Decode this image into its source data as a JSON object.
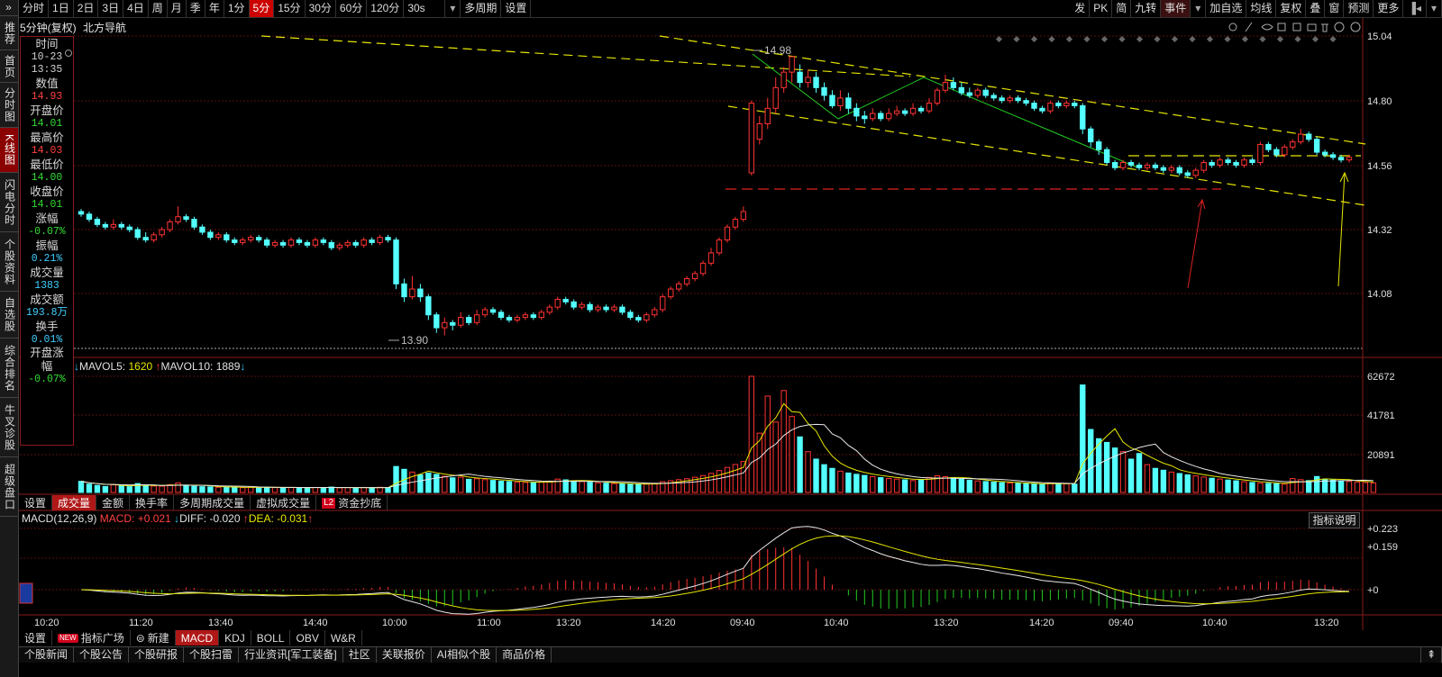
{
  "leftnav": [
    "推荐",
    "首页",
    "分时图",
    "K线图",
    "闪电分时",
    "个股资料",
    "自选股",
    "综合排名",
    "牛叉诊股",
    "超级盘口"
  ],
  "leftnav_expand": "»",
  "toolbar": {
    "periods": [
      "分时",
      "1日",
      "2日",
      "3日",
      "4日",
      "周",
      "月",
      "季",
      "年",
      "1分",
      "5分",
      "15分",
      "30分",
      "60分",
      "120分",
      "30s",
      "多周期",
      "设置"
    ],
    "active_period": "5分",
    "right": [
      "发",
      "PK",
      "简",
      "九转",
      "事件",
      "加自选",
      "均线",
      "复权",
      "叠",
      "窗",
      "预测",
      "更多"
    ]
  },
  "stock": {
    "period_label": "5分钟(复权)",
    "name": "北方导航"
  },
  "info": [
    {
      "label": "时间",
      "value": "10-23",
      "color": "#d0d0d0"
    },
    {
      "label": "",
      "value": "13:35",
      "color": "#d0d0d0"
    },
    {
      "label": "数值",
      "value": "14.93",
      "color": "#ff4040"
    },
    {
      "label": "开盘价",
      "value": "14.01",
      "color": "#33dd33"
    },
    {
      "label": "最高价",
      "value": "14.03",
      "color": "#ff4040"
    },
    {
      "label": "最低价",
      "value": "14.00",
      "color": "#33dd33"
    },
    {
      "label": "收盘价",
      "value": "14.01",
      "color": "#33dd33"
    },
    {
      "label": "涨幅",
      "value": "-0.07%",
      "color": "#33dd33"
    },
    {
      "label": "振幅",
      "value": "0.21%",
      "color": "#3ecfff"
    },
    {
      "label": "成交量",
      "value": "1383",
      "color": "#3ecfff"
    },
    {
      "label": "成交额",
      "value": "193.8万",
      "color": "#3ecfff"
    },
    {
      "label": "换手",
      "value": "0.01%",
      "color": "#3ecfff"
    },
    {
      "label": "开盘涨幅",
      "value": "-0.07%",
      "color": "#33dd33"
    }
  ],
  "price_axis": [
    "15.04",
    "14.80",
    "14.56",
    "14.32",
    "14.08"
  ],
  "vol_axis": [
    "62672",
    "41781",
    "20891"
  ],
  "macd_axis": [
    "+0.223",
    "+0.159",
    "+0"
  ],
  "annotations": {
    "high": "14.98",
    "low": "13.90"
  },
  "vol_legend": {
    "ma5_label": "MAVOL5:",
    "ma5": "1620",
    "ma10_label": "MAVOL10:",
    "ma10": "1889"
  },
  "vol_tabs": [
    "设置",
    "成交量",
    "金额",
    "换手率",
    "多周期成交量",
    "虚拟成交量",
    "资金抄底"
  ],
  "vol_tab_active": "成交量",
  "macd_legend": {
    "name": "MACD(12,26,9)",
    "macd_label": "MACD:",
    "macd": "+0.021",
    "diff_label": "DIFF:",
    "diff": "-0.020",
    "dea_label": "DEA:",
    "dea": "-0.031"
  },
  "indicator_button": "指标说明",
  "time_axis": [
    "10:20",
    "11:20",
    "13:40",
    "14:40",
    "10:00",
    "11:00",
    "13:20",
    "14:20",
    "09:40",
    "10:40",
    "13:20",
    "14:20",
    "09:40",
    "10:40",
    "13:20"
  ],
  "indic_tabs": [
    "设置",
    "指标广场",
    "新建",
    "MACD",
    "KDJ",
    "BOLL",
    "OBV",
    "W&R"
  ],
  "indic_tab_active": "MACD",
  "new_badge": "NEW",
  "l2_badge": "L2",
  "news_tabs": [
    "个股新闻",
    "个股公告",
    "个股研报",
    "个股扫雷",
    "行业资讯[军工装备]",
    "社区",
    "关联报价",
    "AI相似个股",
    "商品价格"
  ],
  "chart_data": {
    "type": "candlestick",
    "price_range": [
      13.85,
      15.06
    ],
    "candles": [
      [
        14.38,
        14.37,
        14.39,
        14.36
      ],
      [
        14.37,
        14.35,
        14.38,
        14.34
      ],
      [
        14.35,
        14.33,
        14.36,
        14.32
      ],
      [
        14.33,
        14.32,
        14.34,
        14.31
      ],
      [
        14.32,
        14.33,
        14.35,
        14.31
      ],
      [
        14.33,
        14.32,
        14.34,
        14.31
      ],
      [
        14.32,
        14.31,
        14.33,
        14.3
      ],
      [
        14.31,
        14.28,
        14.32,
        14.27
      ],
      [
        14.28,
        14.27,
        14.3,
        14.26
      ],
      [
        14.27,
        14.29,
        14.3,
        14.26
      ],
      [
        14.29,
        14.31,
        14.32,
        14.28
      ],
      [
        14.31,
        14.34,
        14.35,
        14.3
      ],
      [
        14.34,
        14.36,
        14.4,
        14.33
      ],
      [
        14.36,
        14.35,
        14.37,
        14.34
      ],
      [
        14.35,
        14.32,
        14.36,
        14.31
      ],
      [
        14.32,
        14.3,
        14.33,
        14.29
      ],
      [
        14.3,
        14.28,
        14.31,
        14.27
      ],
      [
        14.28,
        14.29,
        14.3,
        14.27
      ],
      [
        14.29,
        14.27,
        14.3,
        14.26
      ],
      [
        14.27,
        14.26,
        14.28,
        14.25
      ],
      [
        14.26,
        14.27,
        14.28,
        14.25
      ],
      [
        14.27,
        14.28,
        14.29,
        14.26
      ],
      [
        14.28,
        14.27,
        14.29,
        14.26
      ],
      [
        14.27,
        14.25,
        14.28,
        14.24
      ],
      [
        14.25,
        14.26,
        14.27,
        14.24
      ],
      [
        14.26,
        14.25,
        14.27,
        14.24
      ],
      [
        14.25,
        14.27,
        14.28,
        14.24
      ],
      [
        14.27,
        14.26,
        14.28,
        14.25
      ],
      [
        14.26,
        14.25,
        14.27,
        14.24
      ],
      [
        14.25,
        14.27,
        14.28,
        14.24
      ],
      [
        14.27,
        14.26,
        14.28,
        14.25
      ],
      [
        14.26,
        14.24,
        14.27,
        14.23
      ],
      [
        14.24,
        14.25,
        14.26,
        14.23
      ],
      [
        14.25,
        14.26,
        14.27,
        14.24
      ],
      [
        14.26,
        14.25,
        14.27,
        14.24
      ],
      [
        14.25,
        14.27,
        14.28,
        14.24
      ],
      [
        14.27,
        14.26,
        14.28,
        14.25
      ],
      [
        14.26,
        14.28,
        14.29,
        14.25
      ],
      [
        14.28,
        14.27,
        14.29,
        14.26
      ],
      [
        14.27,
        14.1,
        14.28,
        14.08
      ],
      [
        14.1,
        14.05,
        14.12,
        14.03
      ],
      [
        14.05,
        14.08,
        14.13,
        14.04
      ],
      [
        14.08,
        14.05,
        14.1,
        14.03
      ],
      [
        14.05,
        13.98,
        14.06,
        13.96
      ],
      [
        13.98,
        13.93,
        13.99,
        13.91
      ],
      [
        13.93,
        13.95,
        13.97,
        13.9
      ],
      [
        13.95,
        13.94,
        13.96,
        13.92
      ],
      [
        13.94,
        13.97,
        13.99,
        13.93
      ],
      [
        13.97,
        13.95,
        13.98,
        13.94
      ],
      [
        13.95,
        13.98,
        14.0,
        13.94
      ],
      [
        13.98,
        14.0,
        14.01,
        13.97
      ],
      [
        14.0,
        13.99,
        14.01,
        13.98
      ],
      [
        13.99,
        13.97,
        14.0,
        13.96
      ],
      [
        13.97,
        13.96,
        13.98,
        13.95
      ],
      [
        13.96,
        13.97,
        13.98,
        13.95
      ],
      [
        13.97,
        13.98,
        13.99,
        13.96
      ],
      [
        13.98,
        13.97,
        13.99,
        13.96
      ],
      [
        13.97,
        13.99,
        14.0,
        13.96
      ],
      [
        13.99,
        14.01,
        14.02,
        13.98
      ],
      [
        14.01,
        14.04,
        14.05,
        14.0
      ],
      [
        14.04,
        14.03,
        14.05,
        14.02
      ],
      [
        14.03,
        14.01,
        14.04,
        14.0
      ],
      [
        14.01,
        14.02,
        14.03,
        14.0
      ],
      [
        14.02,
        14.0,
        14.03,
        13.99
      ],
      [
        14.0,
        14.01,
        14.02,
        13.99
      ],
      [
        14.01,
        14.0,
        14.02,
        13.99
      ],
      [
        14.0,
        14.01,
        14.02,
        13.99
      ],
      [
        14.01,
        13.99,
        14.02,
        13.98
      ],
      [
        13.99,
        13.97,
        14.0,
        13.96
      ],
      [
        13.97,
        13.96,
        13.98,
        13.95
      ],
      [
        13.96,
        13.98,
        13.99,
        13.95
      ],
      [
        13.98,
        14.0,
        14.01,
        13.97
      ],
      [
        14.0,
        14.05,
        14.06,
        13.99
      ],
      [
        14.05,
        14.08,
        14.09,
        14.04
      ],
      [
        14.08,
        14.1,
        14.11,
        14.07
      ],
      [
        14.1,
        14.12,
        14.13,
        14.09
      ],
      [
        14.12,
        14.14,
        14.15,
        14.11
      ],
      [
        14.14,
        14.18,
        14.19,
        14.13
      ],
      [
        14.18,
        14.22,
        14.24,
        14.17
      ],
      [
        14.22,
        14.27,
        14.28,
        14.21
      ],
      [
        14.27,
        14.32,
        14.33,
        14.26
      ],
      [
        14.32,
        14.35,
        14.36,
        14.31
      ],
      [
        14.35,
        14.38,
        14.4,
        14.34
      ],
      [
        14.53,
        14.8,
        14.81,
        14.52
      ],
      [
        14.66,
        14.72,
        14.75,
        14.64
      ],
      [
        14.72,
        14.78,
        14.82,
        14.7
      ],
      [
        14.78,
        14.86,
        14.9,
        14.76
      ],
      [
        14.86,
        14.92,
        14.94,
        14.84
      ],
      [
        14.92,
        14.98,
        14.98,
        14.88
      ],
      [
        14.92,
        14.88,
        14.95,
        14.86
      ],
      [
        14.88,
        14.9,
        14.93,
        14.86
      ],
      [
        14.9,
        14.86,
        14.92,
        14.84
      ],
      [
        14.86,
        14.83,
        14.88,
        14.81
      ],
      [
        14.83,
        14.79,
        14.85,
        14.78
      ],
      [
        14.79,
        14.82,
        14.85,
        14.77
      ],
      [
        14.82,
        14.78,
        14.84,
        14.76
      ],
      [
        14.78,
        14.75,
        14.8,
        14.73
      ],
      [
        14.75,
        14.74,
        14.77,
        14.72
      ],
      [
        14.74,
        14.76,
        14.78,
        14.73
      ],
      [
        14.76,
        14.74,
        14.77,
        14.73
      ],
      [
        14.74,
        14.76,
        14.78,
        14.73
      ],
      [
        14.76,
        14.77,
        14.79,
        14.75
      ],
      [
        14.77,
        14.76,
        14.78,
        14.75
      ],
      [
        14.76,
        14.78,
        14.8,
        14.75
      ],
      [
        14.78,
        14.77,
        14.79,
        14.76
      ],
      [
        14.77,
        14.8,
        14.82,
        14.76
      ],
      [
        14.8,
        14.85,
        14.86,
        14.79
      ],
      [
        14.85,
        14.88,
        14.91,
        14.84
      ],
      [
        14.88,
        14.86,
        14.9,
        14.85
      ],
      [
        14.86,
        14.84,
        14.88,
        14.83
      ],
      [
        14.84,
        14.83,
        14.86,
        14.82
      ],
      [
        14.83,
        14.85,
        14.86,
        14.82
      ],
      [
        14.85,
        14.83,
        14.86,
        14.82
      ],
      [
        14.83,
        14.82,
        14.84,
        14.81
      ],
      [
        14.82,
        14.81,
        14.83,
        14.8
      ],
      [
        14.81,
        14.82,
        14.83,
        14.8
      ],
      [
        14.82,
        14.81,
        14.83,
        14.8
      ],
      [
        14.81,
        14.8,
        14.82,
        14.79
      ],
      [
        14.8,
        14.78,
        14.81,
        14.77
      ],
      [
        14.78,
        14.77,
        14.79,
        14.76
      ],
      [
        14.77,
        14.8,
        14.81,
        14.76
      ],
      [
        14.8,
        14.79,
        14.81,
        14.78
      ],
      [
        14.79,
        14.8,
        14.81,
        14.78
      ],
      [
        14.8,
        14.79,
        14.81,
        14.78
      ],
      [
        14.79,
        14.7,
        14.8,
        14.68
      ],
      [
        14.7,
        14.65,
        14.71,
        14.63
      ],
      [
        14.65,
        14.62,
        14.66,
        14.6
      ],
      [
        14.62,
        14.57,
        14.63,
        14.56
      ],
      [
        14.57,
        14.55,
        14.58,
        14.54
      ],
      [
        14.55,
        14.57,
        14.58,
        14.54
      ],
      [
        14.57,
        14.56,
        14.58,
        14.55
      ],
      [
        14.56,
        14.55,
        14.57,
        14.54
      ],
      [
        14.55,
        14.56,
        14.57,
        14.54
      ],
      [
        14.56,
        14.55,
        14.57,
        14.54
      ],
      [
        14.55,
        14.54,
        14.56,
        14.53
      ],
      [
        14.54,
        14.55,
        14.56,
        14.53
      ],
      [
        14.55,
        14.53,
        14.56,
        14.52
      ],
      [
        14.53,
        14.52,
        14.54,
        14.51
      ],
      [
        14.52,
        14.54,
        14.55,
        14.51
      ],
      [
        14.54,
        14.57,
        14.58,
        14.53
      ],
      [
        14.57,
        14.56,
        14.58,
        14.55
      ],
      [
        14.56,
        14.58,
        14.59,
        14.55
      ],
      [
        14.58,
        14.57,
        14.59,
        14.56
      ],
      [
        14.57,
        14.56,
        14.58,
        14.55
      ],
      [
        14.56,
        14.58,
        14.59,
        14.55
      ],
      [
        14.58,
        14.57,
        14.59,
        14.56
      ],
      [
        14.57,
        14.64,
        14.65,
        14.56
      ],
      [
        14.64,
        14.62,
        14.65,
        14.61
      ],
      [
        14.62,
        14.6,
        14.63,
        14.59
      ],
      [
        14.6,
        14.63,
        14.64,
        14.59
      ],
      [
        14.63,
        14.65,
        14.66,
        14.62
      ],
      [
        14.65,
        14.68,
        14.7,
        14.64
      ],
      [
        14.68,
        14.66,
        14.69,
        14.65
      ],
      [
        14.66,
        14.61,
        14.67,
        14.6
      ],
      [
        14.61,
        14.6,
        14.62,
        14.59
      ],
      [
        14.6,
        14.59,
        14.61,
        14.58
      ],
      [
        14.59,
        14.58,
        14.6,
        14.57
      ],
      [
        14.58,
        14.59,
        14.6,
        14.57
      ]
    ],
    "volume": [
      6000,
      4500,
      3800,
      3200,
      4100,
      3600,
      3100,
      4800,
      3900,
      3500,
      3400,
      4200,
      5100,
      3600,
      3300,
      3100,
      3000,
      2800,
      2900,
      2700,
      2600,
      2800,
      2700,
      2900,
      2600,
      2500,
      2700,
      2600,
      2500,
      2700,
      2600,
      2900,
      2500,
      2600,
      2400,
      2700,
      2600,
      2800,
      2500,
      14000,
      12500,
      11000,
      9500,
      10500,
      9800,
      8700,
      7900,
      8200,
      7100,
      7400,
      6900,
      6500,
      6100,
      5900,
      5600,
      5400,
      5200,
      5500,
      6100,
      7200,
      6800,
      6300,
      5900,
      5500,
      5200,
      5000,
      4800,
      4600,
      4400,
      4300,
      4500,
      4900,
      5800,
      6300,
      6900,
      7400,
      8200,
      9100,
      10300,
      11800,
      13500,
      15100,
      16700,
      62672,
      32000,
      52000,
      38000,
      55000,
      41000,
      30000,
      22000,
      18000,
      15000,
      13000,
      11500,
      10500,
      9800,
      9200,
      8500,
      8000,
      7500,
      7200,
      6800,
      6400,
      7000,
      8100,
      9000,
      8500,
      7800,
      7100,
      6600,
      6200,
      5900,
      5600,
      5300,
      5100,
      4900,
      4700,
      4500,
      4300,
      5200,
      4900,
      4700,
      4500,
      58000,
      34000,
      29000,
      27000,
      24000,
      22000,
      18000,
      21000,
      15000,
      13000,
      12000,
      11000,
      10200,
      9500,
      8900,
      8300,
      7700,
      7200,
      6700,
      6300,
      5800,
      5400,
      5100,
      4900,
      4700,
      4500,
      7500,
      6900,
      6400,
      8600,
      7200,
      6700,
      6200,
      5900,
      5600,
      5300,
      5100
    ]
  }
}
